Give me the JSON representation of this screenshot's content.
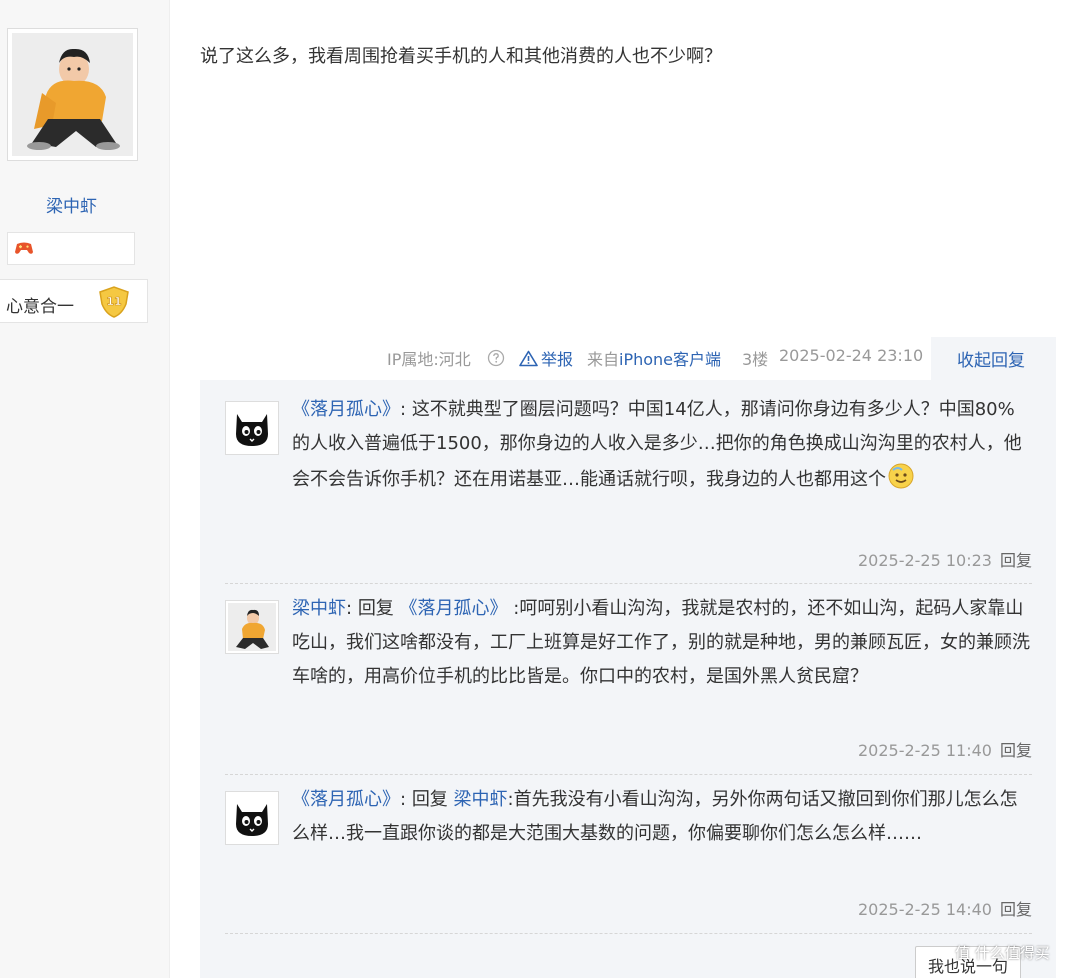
{
  "author": {
    "name": "梁中虾",
    "level_name": "心意合一",
    "level_number": "11"
  },
  "post": {
    "content": "说了这么多，我看周围抢着买手机的人和其他消费的人也不少啊？",
    "meta": {
      "ip_location": "IP属地:河北",
      "report": "举报",
      "from_prefix": "来自",
      "client": "iPhone客户端",
      "floor": "3楼",
      "time": "2025-02-24 23:10",
      "collapse": "收起回复"
    }
  },
  "replies": [
    {
      "user": "《落月孤心》",
      "sep": ":",
      "reply_prefix": "",
      "quote": "",
      "text": "这不就典型了圈层问题吗？中国14亿人，那请问你身边有多少人？中国80%的人收入普遍低于1500，那你身边的人收入是多少…把你的角色换成山沟沟里的农村人，他会不会告诉你手机？还在用诺基亚…能通话就行呗，我身边的人也都用这个",
      "time": "2025-2-25 10:23",
      "reply_label": "回复"
    },
    {
      "user": "梁中虾",
      "sep": ":",
      "reply_prefix": "回复",
      "quote": "《落月孤心》",
      "text": ":呵呵别小看山沟沟，我就是农村的，还不如山沟，起码人家靠山吃山，我们这啥都没有，工厂上班算是好工作了，别的就是种地，男的兼顾瓦匠，女的兼顾洗车啥的，用高价位手机的比比皆是。你口中的农村，是国外黑人贫民窟？",
      "time": "2025-2-25 11:40",
      "reply_label": "回复"
    },
    {
      "user": "《落月孤心》",
      "sep": ":",
      "reply_prefix": "回复",
      "quote": "梁中虾",
      "text": ":首先我没有小看山沟沟，另外你两句话又撤回到你们那儿怎么怎么样…我一直跟你谈的都是大范围大基数的问题，你偏要聊你们怎么怎么样……",
      "time": "2025-2-25 14:40",
      "reply_label": "回复"
    }
  ],
  "say_button": "我也说一句",
  "watermark": "值 什么值得买",
  "colors": {
    "link": "#2d64b3",
    "meta": "#999999",
    "panel_bg": "#f3f5f8"
  }
}
